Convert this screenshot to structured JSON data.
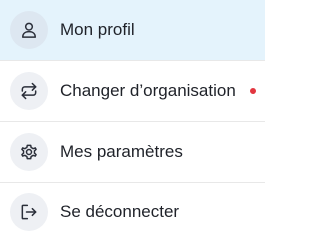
{
  "menu": {
    "items": [
      {
        "label": "Mon profil",
        "icon": "user-icon",
        "active": true
      },
      {
        "label": "Changer d’organisation",
        "icon": "swap-icon",
        "active": false,
        "notification": true
      },
      {
        "label": "Mes paramètres",
        "icon": "gear-icon",
        "active": false
      },
      {
        "label": "Se déconnecter",
        "icon": "logout-icon",
        "active": false
      }
    ]
  },
  "colors": {
    "active_bg": "#e4f3fc",
    "notification_dot": "#e2363f",
    "text": "#1f2229"
  }
}
